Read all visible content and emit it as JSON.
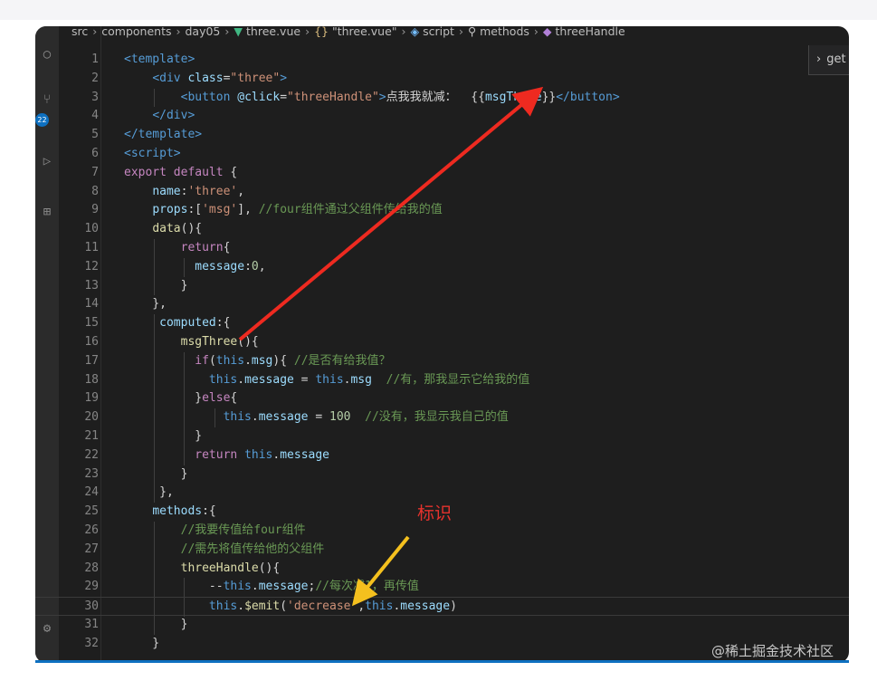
{
  "breadcrumb": {
    "items": [
      "src",
      "components",
      "day05",
      "three.vue",
      "\"three.vue\"",
      "script",
      "methods",
      "threeHandle"
    ],
    "icons": [
      "",
      "",
      "",
      "vue-icon",
      "braces-icon",
      "cube-icon",
      "wrench-icon",
      "method-icon"
    ]
  },
  "sidebar": {
    "badge_count": "22"
  },
  "suggest_widget": {
    "text": "get"
  },
  "editor": {
    "current_line": 30,
    "lines": [
      {
        "n": "1",
        "tokens": [
          [
            "t-tag",
            "<template>"
          ]
        ]
      },
      {
        "n": "2",
        "tokens": [
          [
            "t-plain",
            "    "
          ],
          [
            "t-tag",
            "<div "
          ],
          [
            "t-attr",
            "class"
          ],
          [
            "t-plain",
            "="
          ],
          [
            "t-str",
            "\"three\""
          ],
          [
            "t-tag",
            ">"
          ]
        ]
      },
      {
        "n": "3",
        "tokens": [
          [
            "t-plain",
            "        "
          ],
          [
            "t-tag",
            "<button "
          ],
          [
            "t-attr",
            "@click"
          ],
          [
            "t-plain",
            "="
          ],
          [
            "t-str",
            "\"threeHandle\""
          ],
          [
            "t-tag",
            ">"
          ],
          [
            "t-plain",
            "点我我就减：  {{"
          ],
          [
            "t-prop",
            "msgThree"
          ],
          [
            "t-plain",
            "}}"
          ],
          [
            "t-tag",
            "</button>"
          ]
        ]
      },
      {
        "n": "4",
        "tokens": [
          [
            "t-plain",
            "    "
          ],
          [
            "t-tag",
            "</div>"
          ]
        ]
      },
      {
        "n": "5",
        "tokens": [
          [
            "t-tag",
            "</template>"
          ]
        ]
      },
      {
        "n": "6",
        "tokens": [
          [
            "t-tag",
            "<script>"
          ]
        ]
      },
      {
        "n": "7",
        "tokens": [
          [
            "t-kw",
            "export default"
          ],
          [
            "t-plain",
            " {"
          ]
        ]
      },
      {
        "n": "8",
        "tokens": [
          [
            "t-plain",
            "    "
          ],
          [
            "t-prop",
            "name"
          ],
          [
            "t-plain",
            ":"
          ],
          [
            "t-str",
            "'three'"
          ],
          [
            "t-plain",
            ","
          ]
        ]
      },
      {
        "n": "9",
        "tokens": [
          [
            "t-plain",
            "    "
          ],
          [
            "t-prop",
            "props"
          ],
          [
            "t-plain",
            ":["
          ],
          [
            "t-str",
            "'msg'"
          ],
          [
            "t-plain",
            "], "
          ],
          [
            "t-com",
            "//four组件通过父组件传给我的值"
          ]
        ]
      },
      {
        "n": "10",
        "tokens": [
          [
            "t-plain",
            "    "
          ],
          [
            "t-fn",
            "data"
          ],
          [
            "t-plain",
            "(){"
          ]
        ]
      },
      {
        "n": "11",
        "tokens": [
          [
            "t-plain",
            "        "
          ],
          [
            "t-kw",
            "return"
          ],
          [
            "t-plain",
            "{"
          ]
        ]
      },
      {
        "n": "12",
        "tokens": [
          [
            "t-plain",
            "          "
          ],
          [
            "t-prop",
            "message"
          ],
          [
            "t-plain",
            ":"
          ],
          [
            "t-num",
            "0"
          ],
          [
            "t-plain",
            ","
          ]
        ]
      },
      {
        "n": "13",
        "tokens": [
          [
            "t-plain",
            "        }"
          ]
        ]
      },
      {
        "n": "14",
        "tokens": [
          [
            "t-plain",
            "    },"
          ]
        ]
      },
      {
        "n": "15",
        "tokens": [
          [
            "t-plain",
            "     "
          ],
          [
            "t-prop",
            "computed"
          ],
          [
            "t-plain",
            ":{"
          ]
        ]
      },
      {
        "n": "16",
        "tokens": [
          [
            "t-plain",
            "        "
          ],
          [
            "t-fn",
            "msgThree"
          ],
          [
            "t-plain",
            "(){"
          ]
        ]
      },
      {
        "n": "17",
        "tokens": [
          [
            "t-plain",
            "          "
          ],
          [
            "t-kw",
            "if"
          ],
          [
            "t-plain",
            "("
          ],
          [
            "t-kw2",
            "this"
          ],
          [
            "t-plain",
            "."
          ],
          [
            "t-prop",
            "msg"
          ],
          [
            "t-plain",
            "){ "
          ],
          [
            "t-com",
            "//是否有给我值？"
          ]
        ]
      },
      {
        "n": "18",
        "tokens": [
          [
            "t-plain",
            "            "
          ],
          [
            "t-kw2",
            "this"
          ],
          [
            "t-plain",
            "."
          ],
          [
            "t-prop",
            "message"
          ],
          [
            "t-plain",
            " = "
          ],
          [
            "t-kw2",
            "this"
          ],
          [
            "t-plain",
            "."
          ],
          [
            "t-prop",
            "msg"
          ],
          [
            "t-plain",
            "  "
          ],
          [
            "t-com",
            "//有，那我显示它给我的值"
          ]
        ]
      },
      {
        "n": "19",
        "tokens": [
          [
            "t-plain",
            "          }"
          ],
          [
            "t-kw",
            "else"
          ],
          [
            "t-plain",
            "{"
          ]
        ]
      },
      {
        "n": "20",
        "tokens": [
          [
            "t-plain",
            "              "
          ],
          [
            "t-kw2",
            "this"
          ],
          [
            "t-plain",
            "."
          ],
          [
            "t-prop",
            "message"
          ],
          [
            "t-plain",
            " = "
          ],
          [
            "t-num",
            "100"
          ],
          [
            "t-plain",
            "  "
          ],
          [
            "t-com",
            "//没有，我显示我自己的值"
          ]
        ]
      },
      {
        "n": "21",
        "tokens": [
          [
            "t-plain",
            "          }"
          ]
        ]
      },
      {
        "n": "22",
        "tokens": [
          [
            "t-plain",
            "          "
          ],
          [
            "t-kw",
            "return"
          ],
          [
            "t-plain",
            " "
          ],
          [
            "t-kw2",
            "this"
          ],
          [
            "t-plain",
            "."
          ],
          [
            "t-prop",
            "message"
          ]
        ]
      },
      {
        "n": "23",
        "tokens": [
          [
            "t-plain",
            "        }"
          ]
        ]
      },
      {
        "n": "24",
        "tokens": [
          [
            "t-plain",
            "     },"
          ]
        ]
      },
      {
        "n": "25",
        "tokens": [
          [
            "t-plain",
            "    "
          ],
          [
            "t-prop",
            "methods"
          ],
          [
            "t-plain",
            ":{"
          ]
        ]
      },
      {
        "n": "26",
        "tokens": [
          [
            "t-plain",
            "        "
          ],
          [
            "t-com",
            "//我要传值给four组件"
          ]
        ]
      },
      {
        "n": "27",
        "tokens": [
          [
            "t-plain",
            "        "
          ],
          [
            "t-com",
            "//需先将值传给他的父组件"
          ]
        ]
      },
      {
        "n": "28",
        "tokens": [
          [
            "t-plain",
            "        "
          ],
          [
            "t-fn",
            "threeHandle"
          ],
          [
            "t-plain",
            "(){"
          ]
        ]
      },
      {
        "n": "29",
        "tokens": [
          [
            "t-plain",
            "            --"
          ],
          [
            "t-kw2",
            "this"
          ],
          [
            "t-plain",
            "."
          ],
          [
            "t-prop",
            "message"
          ],
          [
            "t-plain",
            ";"
          ],
          [
            "t-com",
            "//每次减1，再传值"
          ]
        ]
      },
      {
        "n": "30",
        "tokens": [
          [
            "t-plain",
            "            "
          ],
          [
            "t-kw2",
            "this"
          ],
          [
            "t-plain",
            "."
          ],
          [
            "t-fn",
            "$emit"
          ],
          [
            "t-plain",
            "("
          ],
          [
            "t-str",
            "'decrease'"
          ],
          [
            "t-plain",
            ","
          ],
          [
            "t-kw2",
            "this"
          ],
          [
            "t-plain",
            "."
          ],
          [
            "t-prop",
            "message"
          ],
          [
            "t-plain",
            ")"
          ]
        ]
      },
      {
        "n": "31",
        "tokens": [
          [
            "t-plain",
            "        }"
          ]
        ]
      },
      {
        "n": "32",
        "tokens": [
          [
            "t-plain",
            "    }"
          ]
        ]
      }
    ]
  },
  "annotations": {
    "mark_label": "标识",
    "arrow_colors": {
      "red": "#ee2a20",
      "yellow": "#f4c01e"
    }
  },
  "watermark": "@稀土掘金技术社区"
}
